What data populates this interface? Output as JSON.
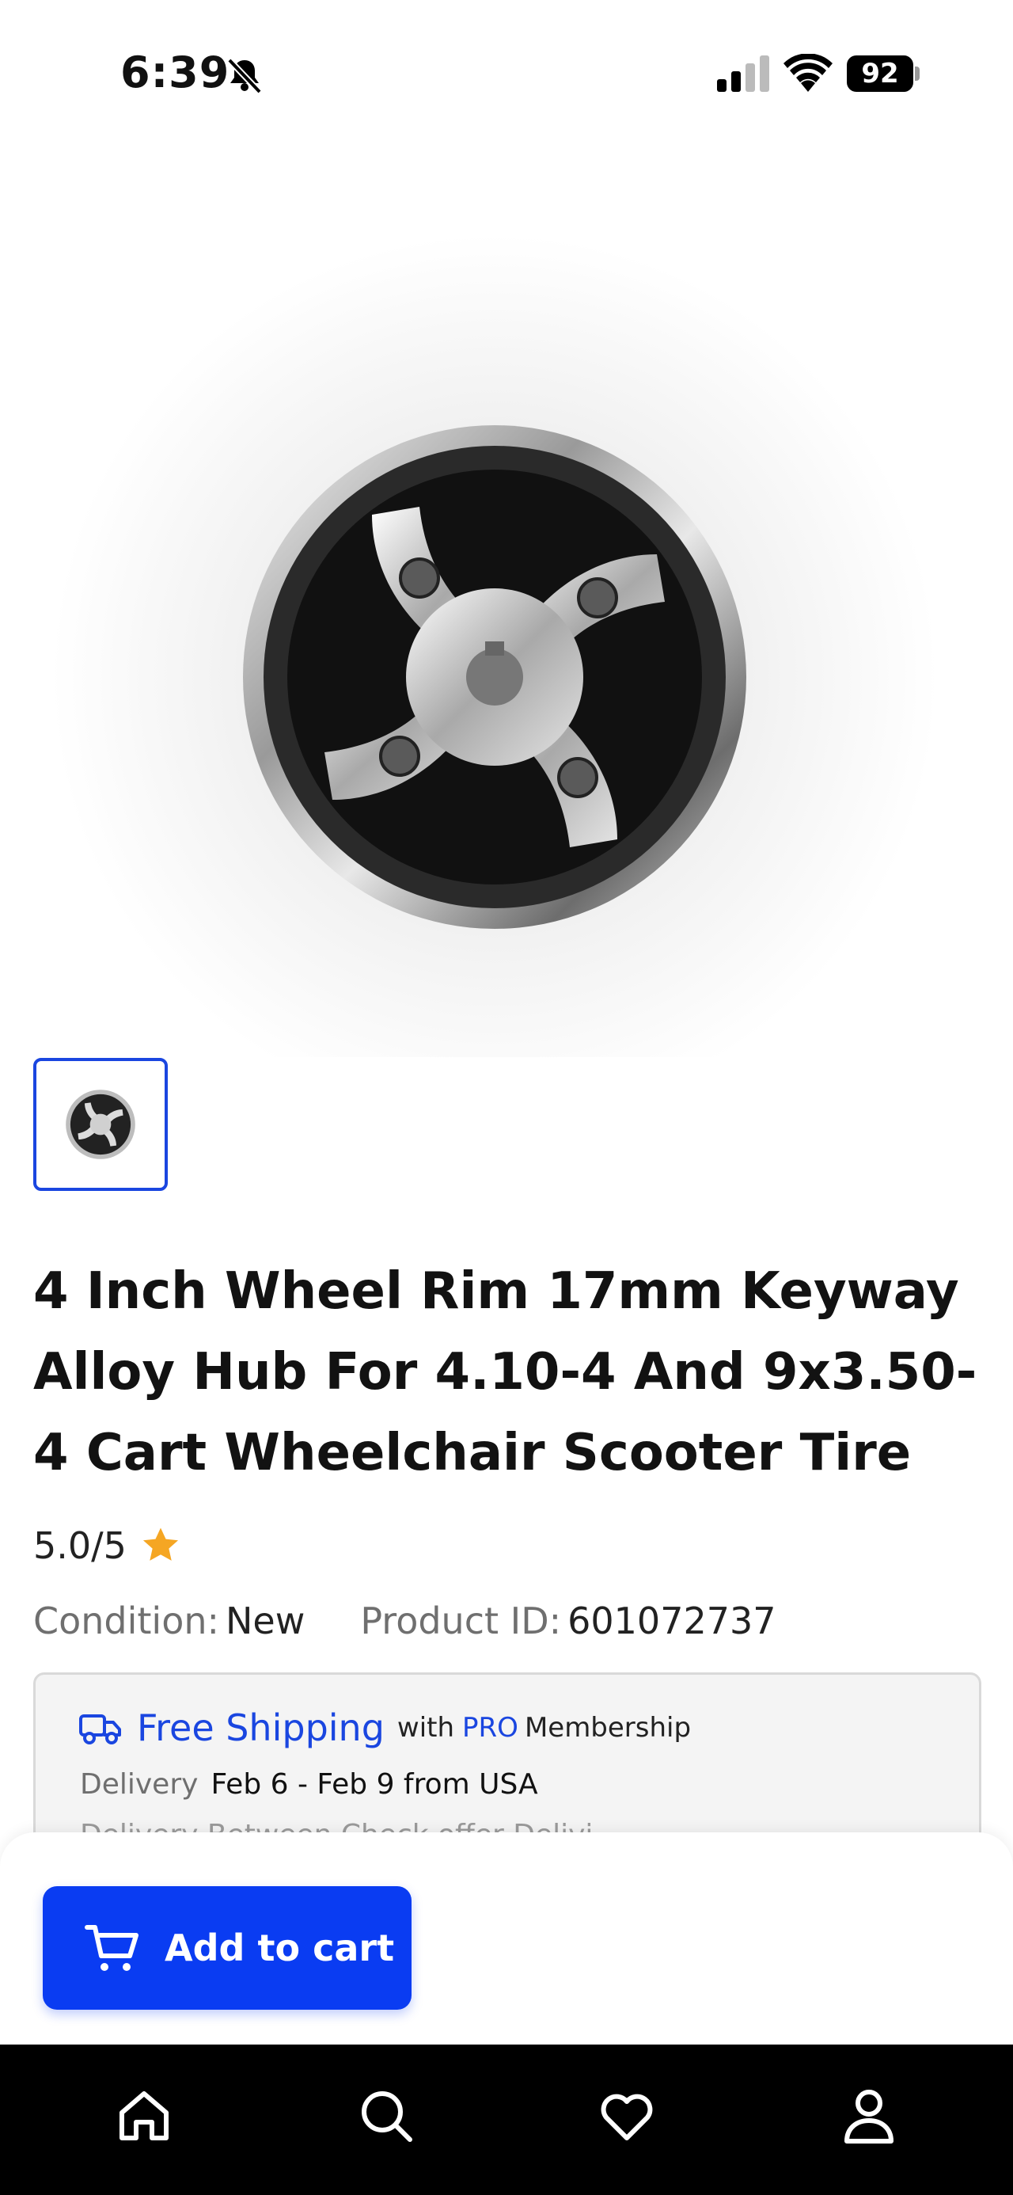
{
  "status_bar": {
    "time": "6:39",
    "battery": "92",
    "icons": [
      "bell-slash-icon",
      "cellular-signal-icon",
      "wifi-icon",
      "battery-icon"
    ]
  },
  "product": {
    "image_icon": "wheel-hub-image",
    "title": "4 Inch Wheel Rim 17mm Keyway Alloy Hub For 4.10-4 And 9x3.50-4 Cart Wheelchair Scooter Tire",
    "rating": "5.0/5",
    "condition_label": "Condition:",
    "condition_value": "New",
    "product_id_label": "Product ID:",
    "product_id_value": "601072737"
  },
  "shipping": {
    "free_shipping": "Free Shipping",
    "with": "with",
    "pro": "PRO",
    "membership": "Membership",
    "delivery_label": "Delivery",
    "delivery_value": "Feb 6 - Feb 9 from USA",
    "partial_line": "Delivery Between Check offer Delivi..."
  },
  "cart": {
    "add_to_cart": "Add to cart"
  },
  "nav": {
    "items": [
      "home-icon",
      "search-icon",
      "heart-icon",
      "profile-icon"
    ]
  },
  "colors": {
    "accent": "#0a3cf2",
    "link": "#1a46e0",
    "star": "#f5a623",
    "nav_bg": "#000000"
  }
}
